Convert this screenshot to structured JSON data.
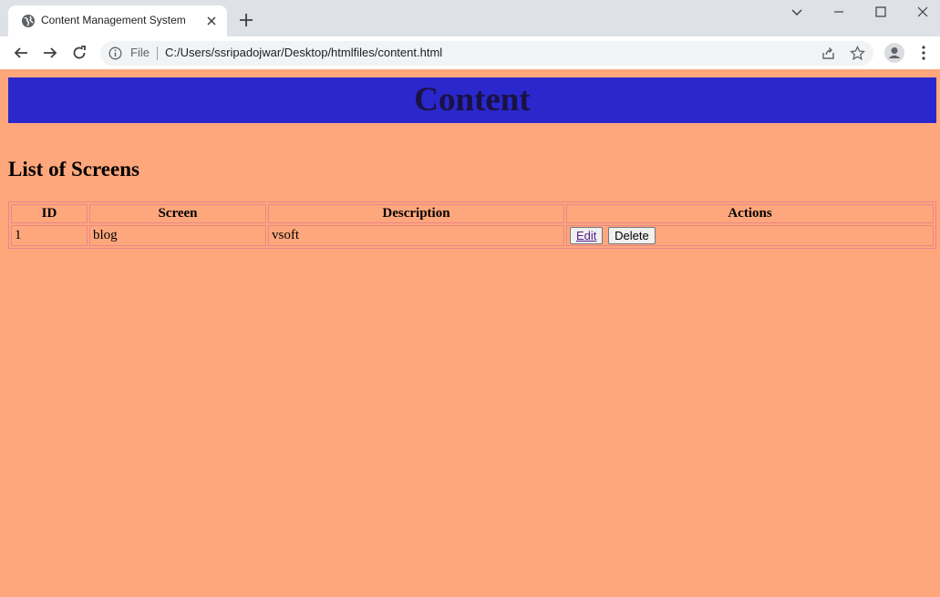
{
  "browser": {
    "tab_title": "Content Management System",
    "omnibox": {
      "scheme_label": "File",
      "url": "C:/Users/ssripadojwar/Desktop/htmlfiles/content.html"
    },
    "icons": [
      "globe-icon",
      "close-icon",
      "plus-icon",
      "chevron-down-icon",
      "minimize-icon",
      "maximize-icon",
      "window-close-icon",
      "back-arrow-icon",
      "forward-arrow-icon",
      "reload-icon",
      "info-icon",
      "share-icon",
      "star-icon",
      "profile-icon",
      "more-vert-icon"
    ]
  },
  "page": {
    "banner_title": "Content",
    "section_title": "List of Screens",
    "colors": {
      "page_bg": "#ffa77c",
      "banner_bg": "#2a27cd",
      "table_border": "#e9868a"
    },
    "table": {
      "headers": [
        "ID",
        "Screen",
        "Description",
        "Actions"
      ],
      "rows": [
        {
          "id": "1",
          "screen": "blog",
          "description": "vsoft",
          "edit_label": "Edit",
          "delete_label": "Delete"
        }
      ]
    }
  }
}
